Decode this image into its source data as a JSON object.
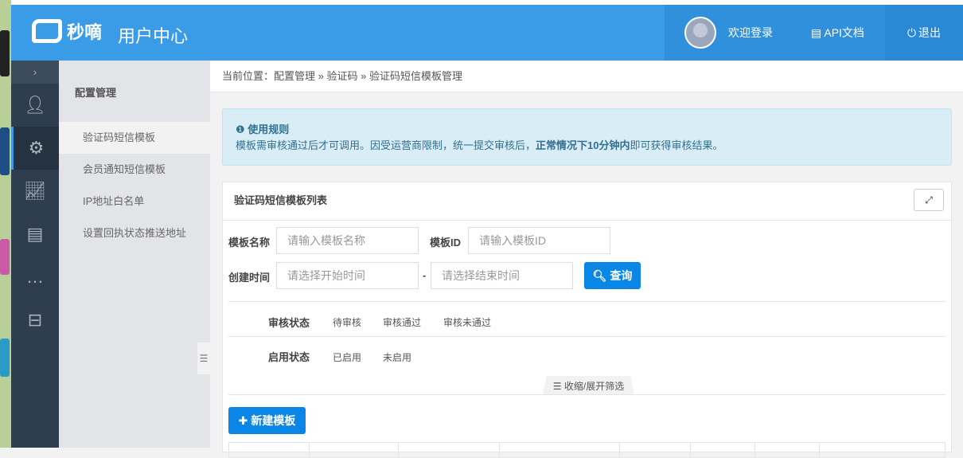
{
  "header": {
    "brand": "秒嘀",
    "title": "用户中心",
    "welcome": "欢迎登录",
    "api_docs": "API文档",
    "logout": "退出"
  },
  "nav": {
    "icons": [
      "user-icon",
      "gear-icon",
      "chart-icon",
      "document-icon",
      "message-icon",
      "bag-icon"
    ]
  },
  "submenu": {
    "title": "配置管理",
    "items": [
      "验证码短信模板",
      "会员通知短信模板",
      "IP地址白名单",
      "设置回执状态推送地址"
    ]
  },
  "breadcrumb": {
    "prefix": "当前位置：",
    "items": [
      "配置管理",
      "验证码",
      "验证码短信模板管理"
    ],
    "sep": "»"
  },
  "notice": {
    "title": "使用规则",
    "text1": "模板需审核通过后才可调用。因受运营商限制，统一提交审核后，",
    "bold": "正常情况下10分钟内",
    "text2": "即可获得审核结果。"
  },
  "panel": {
    "title": "验证码短信模板列表",
    "filters": {
      "name_label": "模板名称",
      "name_placeholder": "请输入模板名称",
      "id_label": "模板ID",
      "id_placeholder": "请输入模板ID",
      "time_label": "创建时间",
      "start_placeholder": "请选择开始时间",
      "dash": "-",
      "end_placeholder": "请选择结束时间",
      "query": "查询"
    },
    "audit": {
      "label": "审核状态",
      "options": [
        "待审核",
        "审核通过",
        "审核未通过"
      ]
    },
    "enable": {
      "label": "启用状态",
      "options": [
        "已启用",
        "未启用"
      ]
    },
    "fold": "收缩/展开筛选",
    "new": "新建模板"
  }
}
